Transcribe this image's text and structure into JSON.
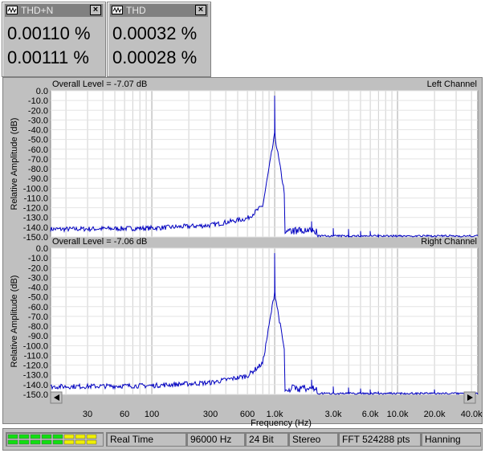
{
  "meters": [
    {
      "title": "THD+N",
      "value1": "0.00110 %",
      "value2": "0.00111 %"
    },
    {
      "title": "THD",
      "value1": "0.00032 %",
      "value2": "0.00028 %"
    }
  ],
  "panels": [
    {
      "overall": "Overall Level = -7.07 dB",
      "channel": "Left Channel",
      "ylabel": "Relative Amplitude (dB)"
    },
    {
      "overall": "Overall Level = -7.06 dB",
      "channel": "Right Channel",
      "ylabel": "Relative Amplitude (dB)"
    }
  ],
  "xaxis": {
    "label": "Frequency (Hz)",
    "ticks": [
      {
        "f": 30,
        "label": "30"
      },
      {
        "f": 60,
        "label": "60"
      },
      {
        "f": 100,
        "label": "100"
      },
      {
        "f": 300,
        "label": "300"
      },
      {
        "f": 600,
        "label": "600"
      },
      {
        "f": 1000,
        "label": "1.0k"
      },
      {
        "f": 3000,
        "label": "3.0k"
      },
      {
        "f": 6000,
        "label": "6.0k"
      },
      {
        "f": 10000,
        "label": "10.0k"
      },
      {
        "f": 20000,
        "label": "20.0k"
      },
      {
        "f": 40000,
        "label": "40.0k"
      }
    ]
  },
  "yticks": [
    "0.0",
    "-10.0",
    "-20.0",
    "-30.0",
    "-40.0",
    "-50.0",
    "-60.0",
    "-70.0",
    "-80.0",
    "-90.0",
    "-100.0",
    "-110.0",
    "-120.0",
    "-130.0",
    "-140.0",
    "-150.0"
  ],
  "status": {
    "mode": "Real Time",
    "rate": "96000 Hz",
    "bits": "24 Bit",
    "channels": "Stereo",
    "fft": "FFT 524288 pts",
    "window": "Hanning"
  },
  "chart_data": [
    {
      "type": "line",
      "title": "Left Channel",
      "xlabel": "Frequency (Hz)",
      "ylabel": "Relative Amplitude (dB)",
      "xscale": "log",
      "xlim": [
        15,
        45000
      ],
      "ylim": [
        -150,
        0
      ],
      "grid": true,
      "color": "#0000c0",
      "peaks": {
        "x": [
          1000,
          2000,
          3000,
          4000,
          5000,
          6000,
          7000
        ],
        "y": [
          -5,
          -134,
          -141,
          -142,
          -144,
          -144,
          -147
        ]
      },
      "noise_floor": {
        "x": [
          20,
          100,
          300,
          600,
          800,
          1000
        ],
        "y": [
          -142,
          -141,
          -138,
          -131,
          -118,
          -45
        ]
      }
    },
    {
      "type": "line",
      "title": "Right Channel",
      "xlabel": "Frequency (Hz)",
      "ylabel": "Relative Amplitude (dB)",
      "xscale": "log",
      "xlim": [
        15,
        45000
      ],
      "ylim": [
        -150,
        0
      ],
      "grid": true,
      "color": "#0000c0",
      "peaks": {
        "x": [
          180,
          1000,
          2000,
          3000,
          4000,
          5000,
          6000,
          7000,
          20000
        ],
        "y": [
          -138,
          -5,
          -135,
          -142,
          -143,
          -144,
          -145,
          -147,
          -145
        ]
      },
      "noise_floor": {
        "x": [
          20,
          100,
          300,
          600,
          800,
          1000
        ],
        "y": [
          -142,
          -141,
          -138,
          -131,
          -118,
          -45
        ]
      }
    }
  ]
}
